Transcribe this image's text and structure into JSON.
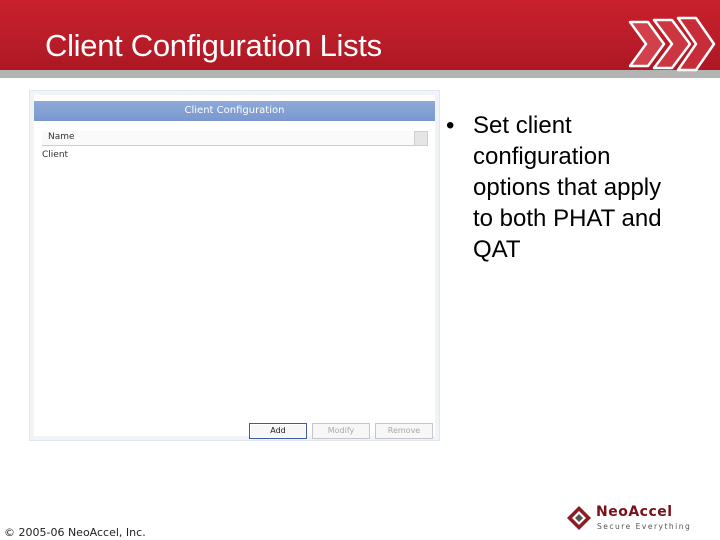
{
  "slide": {
    "title": "Client Configuration Lists",
    "bullet": "Set client configuration options that apply to both PHAT and QAT"
  },
  "screenshot": {
    "header": "Client Configuration",
    "column_header": "Name",
    "rows": [
      "Client"
    ],
    "buttons": {
      "add": "Add",
      "modify": "Modify",
      "remove": "Remove"
    }
  },
  "footer": {
    "copyright": "© 2005-06 NeoAccel, Inc.",
    "logo_name": "NeoAccel",
    "logo_tagline": "Secure Everything"
  },
  "colors": {
    "title_bar": "#b71c28",
    "panel_header": "#7f9dd2",
    "logo": "#7a0f17"
  },
  "icons": {
    "title_ornament": "chevron-arrows-icon",
    "logo_mark": "neoaccel-logo-icon"
  }
}
